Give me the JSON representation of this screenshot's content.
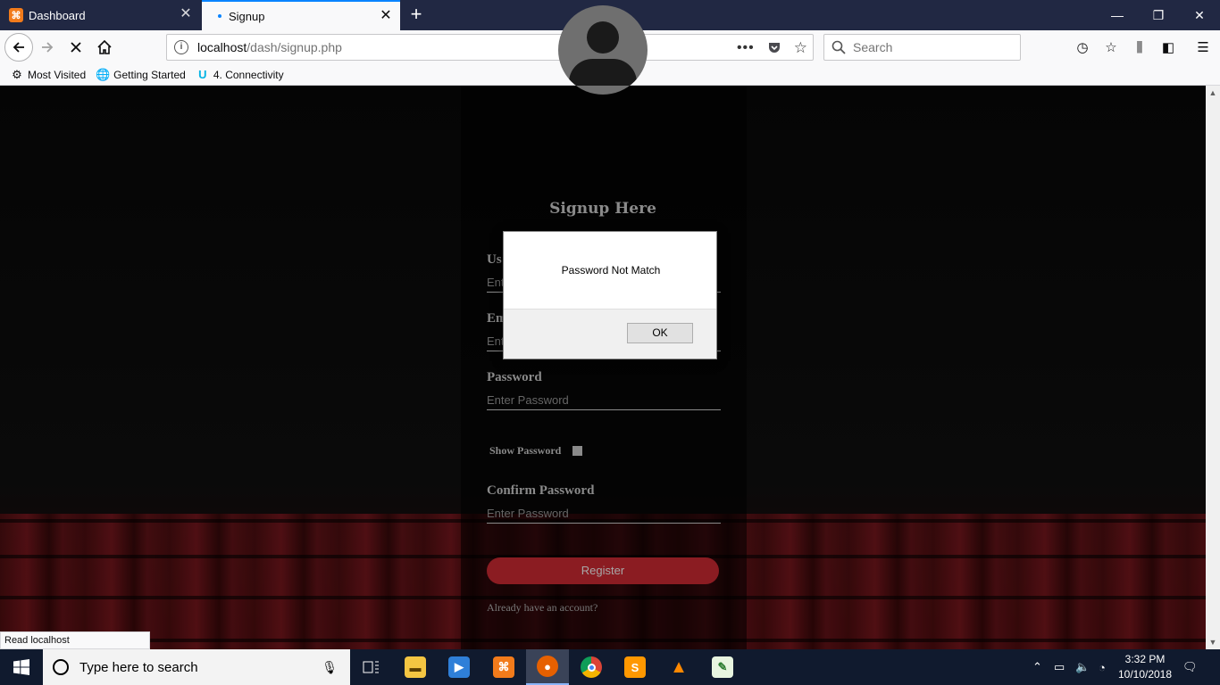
{
  "browser": {
    "tabs": [
      {
        "title": "Dashboard",
        "favicon_letter": "⌘",
        "active": false
      },
      {
        "title": "Signup",
        "active": true
      }
    ],
    "url_host": "localhost",
    "url_path": "/dash/signup.php",
    "search_placeholder": "Search",
    "bookmarks": [
      "Most Visited",
      "Getting Started",
      "4. Connectivity"
    ],
    "status_text": "Read localhost"
  },
  "page": {
    "title": "Signup Here",
    "fields": {
      "username_label": "Us",
      "username_placeholder": "Ente",
      "email_label": "Em",
      "email_placeholder": "Ent",
      "password_label": "Password",
      "password_placeholder": "Enter Password",
      "show_password_label": "Show Password",
      "confirm_label": "Confirm Password",
      "confirm_placeholder": "Enter Password"
    },
    "register_label": "Register",
    "already_text": "Already have an account?"
  },
  "dialog": {
    "message": "Password Not Match",
    "ok_label": "OK"
  },
  "taskbar": {
    "search_placeholder": "Type here to search",
    "time": "3:32 PM",
    "date": "10/10/2018"
  },
  "colors": {
    "accent": "#0a84ff",
    "register": "#8b1c22",
    "taskbar": "#101a2e"
  }
}
